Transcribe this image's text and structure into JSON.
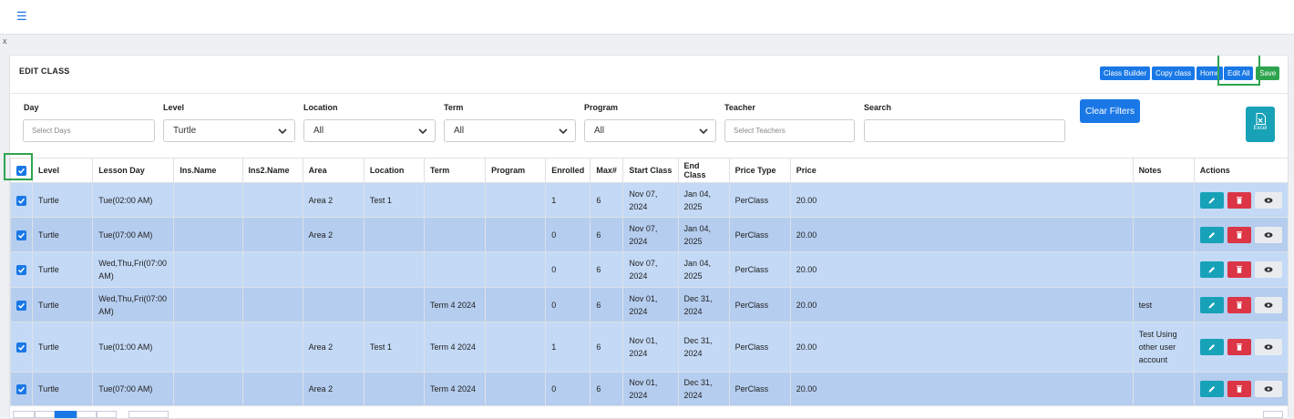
{
  "header": {
    "title": "EDIT CLASS"
  },
  "buttons": {
    "class_builder": "Class Builder",
    "copy_class": "Copy class",
    "home": "Home",
    "edit_all": "Edit All",
    "save": "Save"
  },
  "filters": {
    "day": {
      "label": "Day",
      "placeholder": "Select Days"
    },
    "level": {
      "label": "Level",
      "value": "Turtle"
    },
    "location": {
      "label": "Location",
      "value": "All"
    },
    "term": {
      "label": "Term",
      "value": "All"
    },
    "program": {
      "label": "Program",
      "value": "All"
    },
    "teacher": {
      "label": "Teacher",
      "placeholder": "Select Teachers"
    },
    "search": {
      "label": "Search",
      "placeholder": ""
    },
    "clear_label": "Clear Filters",
    "excel_label": "Excel"
  },
  "table": {
    "columns": [
      "Level",
      "Lesson Day",
      "Ins.Name",
      "Ins2.Name",
      "Area",
      "Location",
      "Term",
      "Program",
      "Enrolled",
      "Max#",
      "Start Class",
      "End Class",
      "Price Type",
      "Price",
      "Notes",
      "Actions"
    ],
    "rows": [
      {
        "level": "Turtle",
        "lesson_day": "Tue(02:00 AM)",
        "ins": "",
        "ins2": "",
        "area": "Area 2",
        "location": "Test 1",
        "term": "",
        "program": "",
        "enrolled": "1",
        "max": "6",
        "start": "Nov 07, 2024",
        "end": "Jan 04, 2025",
        "price_type": "PerClass",
        "price": "20.00",
        "notes": ""
      },
      {
        "level": "Turtle",
        "lesson_day": "Tue(07:00 AM)",
        "ins": "",
        "ins2": "",
        "area": "Area 2",
        "location": "",
        "term": "",
        "program": "",
        "enrolled": "0",
        "max": "6",
        "start": "Nov 07, 2024",
        "end": "Jan 04, 2025",
        "price_type": "PerClass",
        "price": "20.00",
        "notes": ""
      },
      {
        "level": "Turtle",
        "lesson_day": "Wed,Thu,Fri(07:00 AM)",
        "ins": "",
        "ins2": "",
        "area": "",
        "location": "",
        "term": "",
        "program": "",
        "enrolled": "0",
        "max": "6",
        "start": "Nov 07, 2024",
        "end": "Jan 04, 2025",
        "price_type": "PerClass",
        "price": "20.00",
        "notes": ""
      },
      {
        "level": "Turtle",
        "lesson_day": "Wed,Thu,Fri(07:00 AM)",
        "ins": "",
        "ins2": "",
        "area": "",
        "location": "",
        "term": "Term 4 2024",
        "program": "",
        "enrolled": "0",
        "max": "6",
        "start": "Nov 01, 2024",
        "end": "Dec 31, 2024",
        "price_type": "PerClass",
        "price": "20.00",
        "notes": "test"
      },
      {
        "level": "Turtle",
        "lesson_day": "Tue(01:00 AM)",
        "ins": "",
        "ins2": "",
        "area": "Area 2",
        "location": "Test 1",
        "term": "Term 4 2024",
        "program": "",
        "enrolled": "1",
        "max": "6",
        "start": "Nov 01, 2024",
        "end": "Dec 31, 2024",
        "price_type": "PerClass",
        "price": "20.00",
        "notes": "Test Using other user account"
      },
      {
        "level": "Turtle",
        "lesson_day": "Tue(07:00 AM)",
        "ins": "",
        "ins2": "",
        "area": "Area 2",
        "location": "",
        "term": "Term 4 2024",
        "program": "",
        "enrolled": "0",
        "max": "6",
        "start": "Nov 01, 2024",
        "end": "Dec 31, 2024",
        "price_type": "PerClass",
        "price": "20.00",
        "notes": ""
      }
    ]
  },
  "colors": {
    "primary": "#1a78e6",
    "success": "#2ea44f",
    "info": "#17a2b8",
    "danger": "#dc3545",
    "row_a": "#c3d9f6",
    "row_b": "#b5cdef"
  }
}
